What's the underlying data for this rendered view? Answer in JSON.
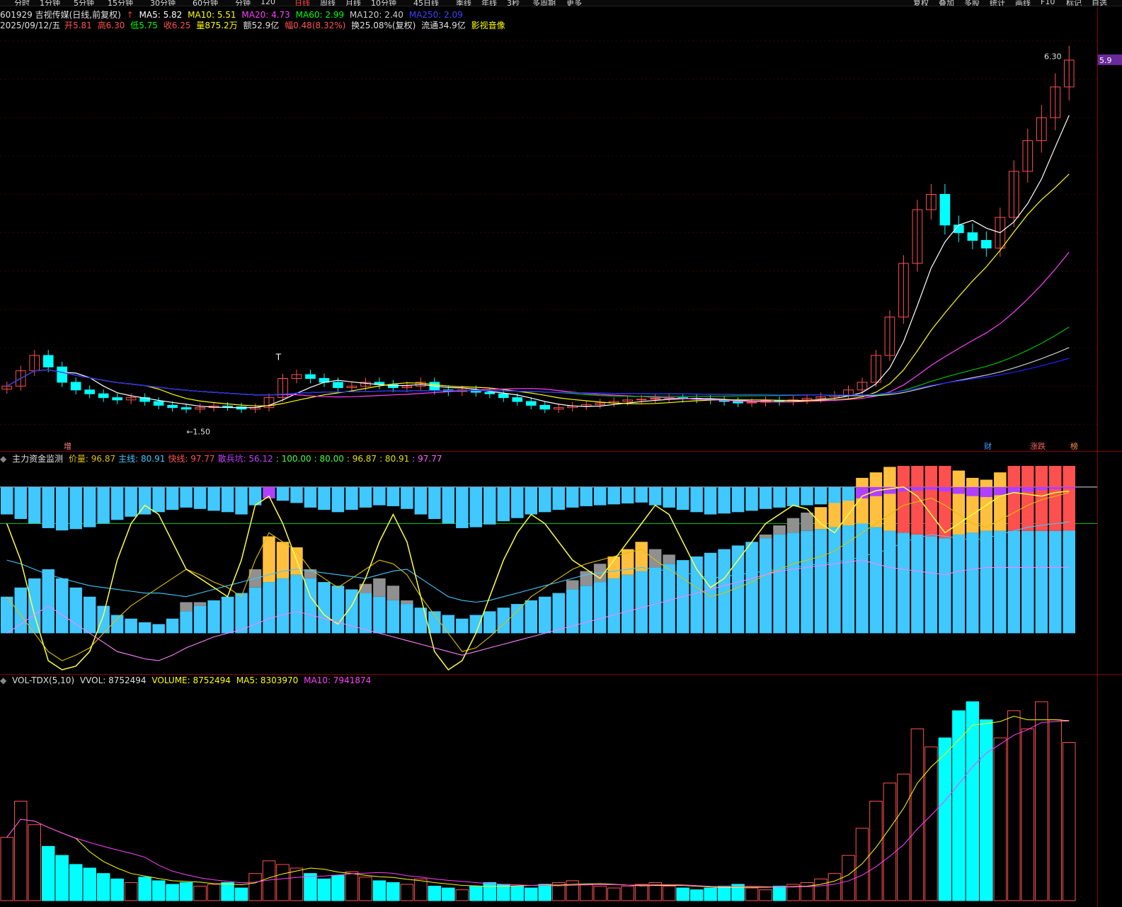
{
  "toolbar": {
    "items": [
      "分时",
      "1分钟",
      "5分钟",
      "15分钟",
      "30分钟",
      "60分钟",
      "分钟",
      "120",
      "日线",
      "周线",
      "月线",
      "10分钟",
      "45日线",
      "季线",
      "年线",
      "3秒",
      "多周期",
      "更多"
    ],
    "active_index": 8,
    "right_items": [
      "复权",
      "叠加",
      "多股",
      "统计",
      "画线",
      "F10",
      "标记",
      "自选"
    ]
  },
  "price_header": {
    "code_name": "601929 吉视传媒(日线,前复权)",
    "ma5": "MA5: 5.82",
    "ma10": "MA10: 5.51",
    "ma20": "MA20: 4.73",
    "ma60": "MA60: 2.99",
    "ma120": "MA120: 2.40",
    "ma250": "MA250: 2.09",
    "date": "2025/09/12/五",
    "open_label": "开",
    "open": "5.81",
    "high_label": "高",
    "high": "6.30",
    "low_label": "低",
    "low": "5.75",
    "close_label": "收",
    "close": "6.25",
    "vol_label": "量",
    "vol": "875.2万",
    "amt_label": "额",
    "amt": "52.9亿",
    "chg_label": "幅",
    "chg": "0.48(8.32%)",
    "turn": "换25.08%(复权)",
    "float": "流通34.9亿",
    "sector": "影视音像"
  },
  "annotations": {
    "high_marker": "6.30",
    "low_marker": "1.50",
    "price_tag": "5.9",
    "t_mark": "T",
    "bottom_tags": [
      "增",
      "财",
      "涨跌",
      "榜"
    ]
  },
  "indicator_header": {
    "name": "主力资金监测",
    "items": [
      {
        "label": "价量: 96.87",
        "color": "#e0c000"
      },
      {
        "label": "主线: 80.91",
        "color": "#40c8ff"
      },
      {
        "label": "快线: 97.77",
        "color": "#ff5050"
      },
      {
        "label": "散兵坑: 56.12",
        "color": "#c040ff"
      },
      {
        "label": ": 100.00",
        "color": "#40ff40"
      },
      {
        "label": ": 80.00",
        "color": "#40ff40"
      },
      {
        "label": ": 96.87",
        "color": "#e0e000"
      },
      {
        "label": ": 80.91",
        "color": "#e0e000"
      },
      {
        "label": ": 97.77",
        "color": "#ff60ff"
      }
    ]
  },
  "volume_header": {
    "name": "VOL-TDX(5,10)",
    "vvol": "VVOL: 8752494",
    "volume": "VOLUME: 8752494",
    "ma5": "MA5: 8303970",
    "ma10": "MA10: 7941874"
  },
  "colors": {
    "up": "#ff5050",
    "down": "#00ffff",
    "ma5": "#ffffff",
    "ma10": "#ffff00",
    "ma20": "#ff40ff",
    "ma60": "#00c000",
    "ma120": "#cccccc",
    "ma250": "#2020ff"
  },
  "chart_data": [
    {
      "type": "candlestick",
      "title": "601929 吉视传媒(日线,前复权)",
      "xlabel": "",
      "ylabel": "",
      "ylim": [
        1.2,
        6.6
      ],
      "grid": true,
      "annotated_high": 6.3,
      "annotated_low": 1.5,
      "close_series": [
        2.0,
        2.2,
        2.4,
        2.25,
        2.05,
        1.95,
        1.9,
        1.85,
        1.82,
        1.85,
        1.8,
        1.75,
        1.72,
        1.7,
        1.72,
        1.74,
        1.73,
        1.7,
        1.72,
        1.85,
        2.1,
        2.15,
        2.1,
        2.05,
        1.98,
        2.0,
        2.05,
        2.02,
        1.98,
        2.0,
        2.05,
        1.95,
        1.93,
        1.95,
        1.92,
        1.9,
        1.85,
        1.8,
        1.75,
        1.7,
        1.72,
        1.74,
        1.76,
        1.78,
        1.8,
        1.82,
        1.83,
        1.84,
        1.85,
        1.84,
        1.83,
        1.82,
        1.8,
        1.78,
        1.79,
        1.81,
        1.8,
        1.82,
        1.84,
        1.86,
        1.88,
        1.95,
        2.05,
        2.4,
        2.9,
        3.6,
        4.3,
        4.5,
        4.1,
        4.0,
        3.9,
        3.8,
        4.2,
        4.8,
        5.2,
        5.5,
        5.9,
        6.25
      ],
      "ma_values": {
        "ma5": 5.82,
        "ma10": 5.51,
        "ma20": 4.73,
        "ma60": 2.99,
        "ma120": 2.4,
        "ma250": 2.09
      }
    },
    {
      "type": "bar",
      "title": "主力资金监测",
      "xlabel": "",
      "ylabel": "",
      "ylim": [
        0,
        110
      ],
      "grid": false,
      "series": [
        {
          "name": "价量",
          "values": [
            40,
            30,
            20,
            10,
            5,
            8,
            12,
            20,
            28,
            35,
            40,
            45,
            50,
            55,
            52,
            48,
            45,
            40,
            60,
            75,
            70,
            65,
            55,
            50,
            45,
            50,
            55,
            60,
            58,
            52,
            40,
            30,
            20,
            10,
            12,
            18,
            25,
            32,
            40,
            45,
            50,
            55,
            58,
            60,
            62,
            64,
            66,
            60,
            55,
            50,
            45,
            40,
            42,
            45,
            48,
            52,
            55,
            58,
            60,
            62,
            65,
            70,
            75,
            80,
            85,
            90,
            92,
            94,
            90,
            85,
            80,
            78,
            82,
            86,
            90,
            93,
            95,
            96.87
          ]
        },
        {
          "name": "主线",
          "values": [
            60,
            58,
            55,
            52,
            50,
            48,
            46,
            45,
            44,
            43,
            42,
            42,
            41,
            40,
            42,
            44,
            46,
            48,
            50,
            52,
            54,
            55,
            54,
            53,
            52,
            51,
            50,
            52,
            54,
            55,
            50,
            45,
            40,
            38,
            37,
            38,
            40,
            42,
            44,
            46,
            48,
            50,
            52,
            53,
            54,
            55,
            56,
            55,
            54,
            53,
            52,
            50,
            51,
            52,
            53,
            54,
            55,
            56,
            57,
            58,
            59,
            60,
            62,
            64,
            66,
            70,
            72,
            74,
            73,
            72,
            71,
            72,
            74,
            76,
            78,
            79,
            80,
            80.91
          ]
        },
        {
          "name": "快线",
          "values": [
            80,
            60,
            30,
            5,
            0,
            2,
            10,
            30,
            60,
            80,
            90,
            85,
            70,
            55,
            50,
            45,
            40,
            60,
            90,
            95,
            80,
            60,
            40,
            30,
            25,
            35,
            50,
            70,
            85,
            70,
            40,
            10,
            0,
            5,
            20,
            40,
            60,
            75,
            85,
            80,
            70,
            60,
            55,
            50,
            60,
            70,
            80,
            90,
            85,
            70,
            55,
            45,
            50,
            60,
            70,
            80,
            85,
            90,
            88,
            80,
            75,
            85,
            95,
            98,
            99,
            100,
            95,
            85,
            75,
            80,
            85,
            90,
            95,
            97,
            96,
            95,
            97,
            97.77
          ]
        },
        {
          "name": "散兵坑",
          "values": [
            20,
            25,
            30,
            35,
            30,
            25,
            20,
            15,
            10,
            8,
            6,
            5,
            8,
            12,
            15,
            18,
            20,
            22,
            25,
            28,
            30,
            32,
            30,
            28,
            26,
            24,
            22,
            20,
            18,
            16,
            14,
            12,
            10,
            8,
            10,
            12,
            14,
            16,
            18,
            20,
            22,
            24,
            26,
            28,
            30,
            32,
            34,
            36,
            38,
            40,
            42,
            44,
            46,
            48,
            50,
            52,
            54,
            55,
            56,
            57,
            58,
            59,
            60,
            58,
            56,
            55,
            54,
            53,
            52,
            54,
            55,
            56,
            56,
            56,
            56,
            56,
            56,
            56.12
          ]
        }
      ],
      "reference_lines": [
        100,
        80
      ]
    },
    {
      "type": "bar",
      "title": "VOL-TDX(5,10)",
      "xlabel": "",
      "ylabel": "",
      "grid": false,
      "values": [
        3.5,
        5.5,
        4.2,
        3.0,
        2.5,
        2.0,
        1.8,
        1.5,
        1.2,
        1.0,
        1.3,
        1.1,
        0.9,
        1.0,
        0.8,
        0.9,
        1.0,
        0.7,
        1.5,
        2.2,
        2.0,
        1.8,
        1.5,
        1.2,
        1.4,
        1.6,
        1.3,
        1.1,
        1.0,
        0.9,
        1.2,
        0.8,
        0.7,
        0.6,
        0.8,
        1.0,
        0.9,
        0.8,
        0.7,
        0.9,
        1.0,
        1.1,
        0.9,
        0.8,
        0.7,
        0.8,
        0.9,
        1.0,
        0.8,
        0.7,
        0.6,
        0.7,
        0.8,
        0.9,
        0.7,
        0.6,
        0.8,
        0.9,
        1.0,
        1.2,
        1.5,
        2.5,
        4.0,
        5.5,
        6.5,
        7.0,
        9.5,
        8.5,
        9.0,
        10.5,
        11.0,
        10.0,
        9.0,
        10.5,
        9.5,
        11.0,
        10.0,
        8.75
      ],
      "ma5": 8303970,
      "ma10": 7941874,
      "latest_volume": 8752494
    }
  ]
}
